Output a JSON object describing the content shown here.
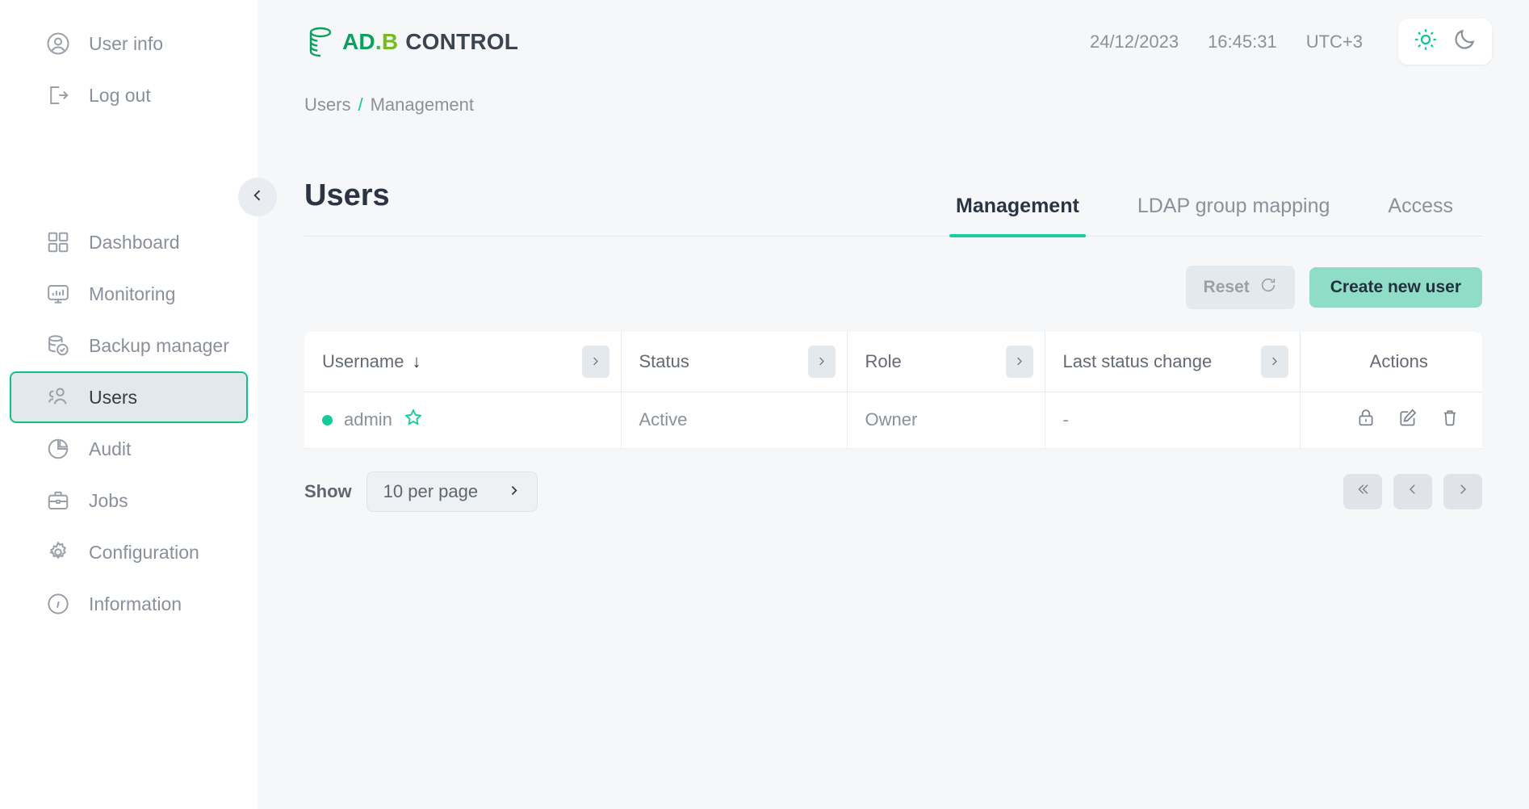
{
  "sidebar": {
    "top_items": [
      {
        "label": "User info",
        "icon": "user-circle-icon"
      },
      {
        "label": "Log out",
        "icon": "logout-icon"
      }
    ],
    "nav_items": [
      {
        "label": "Dashboard",
        "icon": "dashboard-grid-icon",
        "active": false
      },
      {
        "label": "Monitoring",
        "icon": "monitor-chart-icon",
        "active": false
      },
      {
        "label": "Backup manager",
        "icon": "database-check-icon",
        "active": false
      },
      {
        "label": "Users",
        "icon": "users-icon",
        "active": true
      },
      {
        "label": "Audit",
        "icon": "pie-chart-icon",
        "active": false
      },
      {
        "label": "Jobs",
        "icon": "briefcase-icon",
        "active": false
      },
      {
        "label": "Configuration",
        "icon": "gear-icon",
        "active": false
      },
      {
        "label": "Information",
        "icon": "info-circle-icon",
        "active": false
      }
    ],
    "collapse_icon": "chevron-left-icon"
  },
  "header": {
    "logo": {
      "icon": "database-stack-icon",
      "ad": "AD",
      "dot": ".",
      "b": "B",
      "control": "CONTROL"
    },
    "date": "24/12/2023",
    "time": "16:45:31",
    "timezone": "UTC+3",
    "theme": {
      "light_icon": "sun-icon",
      "dark_icon": "moon-icon",
      "active": "light"
    }
  },
  "breadcrumb": {
    "items": [
      "Users",
      "Management"
    ],
    "separator": "/"
  },
  "page": {
    "title": "Users",
    "tabs": [
      {
        "label": "Management",
        "active": true
      },
      {
        "label": "LDAP group mapping",
        "active": false
      },
      {
        "label": "Access",
        "active": false
      }
    ]
  },
  "toolbar": {
    "reset_label": "Reset",
    "reset_icon": "refresh-icon",
    "create_label": "Create new user"
  },
  "table": {
    "columns": [
      {
        "label": "Username",
        "sorted": true,
        "sort_arrow": "↓",
        "has_toggle": true
      },
      {
        "label": "Status",
        "sorted": false,
        "has_toggle": true
      },
      {
        "label": "Role",
        "sorted": false,
        "has_toggle": true
      },
      {
        "label": "Last status change",
        "sorted": false,
        "has_toggle": true
      },
      {
        "label": "Actions",
        "sorted": false,
        "has_toggle": false
      }
    ],
    "rows": [
      {
        "username": "admin",
        "status_dot_color": "#13cb96",
        "favorite_icon": "star-icon",
        "status": "Active",
        "role": "Owner",
        "last_status_change": "-",
        "actions": [
          "lock-icon",
          "edit-icon",
          "delete-icon"
        ]
      }
    ]
  },
  "footer": {
    "show_label": "Show",
    "per_page_value": "10 per page",
    "per_page_icon": "chevron-right-icon",
    "pager": [
      {
        "name": "first-page",
        "icon": "double-chevron-left-icon"
      },
      {
        "name": "prev-page",
        "icon": "chevron-left-icon"
      },
      {
        "name": "next-page",
        "icon": "chevron-right-icon"
      }
    ]
  },
  "colors": {
    "accent_green": "#14cfa0",
    "logo_green": "#0aa15e",
    "logo_lime": "#77bc1f",
    "create_button": "#8fdcc7",
    "page_bg": "#f6f7f9",
    "text_dark": "#2b3445",
    "text_muted": "#8b9199"
  }
}
